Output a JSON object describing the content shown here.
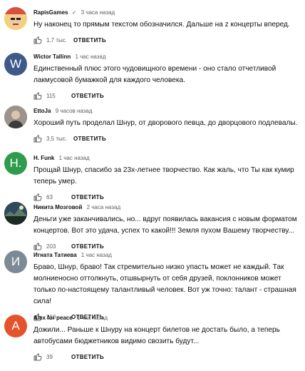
{
  "reply_label": "ОТВЕТИТЬ",
  "comments": [
    {
      "author": "RapisGames",
      "verified_mark": "✓",
      "time": "3 часа назад",
      "text": "Ну наконец то прямым текстом обозначился. Дальше на z концерты вперед.",
      "likes": "1,7 тыс.",
      "avatar_letter": "",
      "avatar_color": "#e9c46a"
    },
    {
      "author": "Wictor Tallinn",
      "time": "1 час назад",
      "text": "Единственный плюс этого чудовищного времени - оно стало отчетливой лакмусовой бумажкой для каждого человека.",
      "likes": "115",
      "avatar_letter": "W",
      "avatar_color": "#3e5a88"
    },
    {
      "author": "EttoJa",
      "time": "9 часов назад",
      "text": "Хороший путь проделал Шнур, от дворового певца, до дворцового подлевалы.",
      "likes": "3,5 тыс.",
      "avatar_letter": "",
      "avatar_color": "#8a7f75"
    },
    {
      "author": "H. Funk",
      "time": "1 час назад",
      "text": "Прощай Шнур, спасибо за 23х-летнее творчество. Как жаль, что Ты как кумир теперь умер.",
      "likes": "63",
      "avatar_letter": "H.",
      "avatar_color": "#2e9b4e"
    },
    {
      "author": "Никита Мозговой",
      "time": "2 часа назад",
      "text": "Деньги уже заканчивались, но... вдруг появилась вакансия с новым форматом концертов. Вот это удача, успех то какой!!! Земля пухом Вашему творчеству...",
      "likes": "203",
      "avatar_letter": "",
      "avatar_color": "#27303a"
    },
    {
      "author": "Игнатa Татиева",
      "time": "1 час назад",
      "text": "Браво, Шнур, браво! Так стремительно низко упасть может не каждый. Так молниеносно оттолкнуть, отшвырнуть от себя друзей, поклонников может только по-настоящему талантливый человек. Вот уж точно: талант - страшная сила!",
      "likes": "210",
      "avatar_letter": "И",
      "avatar_color": "#7b8a94"
    },
    {
      "author": "Alex for peace",
      "time": "1 час назад",
      "text": "Дожили... Раньше к Шнуру на концерт билетов не достать было, а теперь автобусами бюджетников видимо свозить будут...",
      "likes": "39",
      "avatar_letter": "A",
      "avatar_color": "#e5532d"
    }
  ]
}
